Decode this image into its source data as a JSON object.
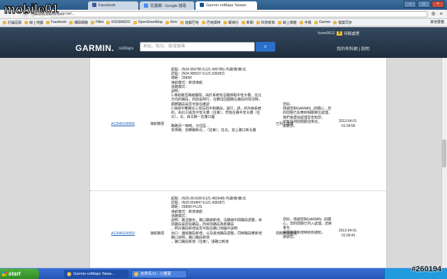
{
  "watermark": {
    "logo": "mobile01",
    "sub": "www.mobile01.com",
    "post_id": "#260194"
  },
  "browser": {
    "tabs": [
      {
        "label": "Facebook",
        "active": false
      },
      {
        "label": "花蓮網 - Google 搜尋",
        "active": false
      },
      {
        "label": "Garmin nüMaps Taiwan",
        "active": true
      }
    ],
    "url": "garmin.tw/...",
    "bookmarks": [
      "討論區版",
      "線上地圖",
      "Facebook",
      "博碩網路",
      "Hifiet",
      "KISSRADIO",
      "OpenStreetMap",
      "Kimi",
      "遊戲巴哈",
      "巴哈姆特",
      "報導社",
      "新聞",
      "科技新知",
      "線上媒體",
      "手機",
      "Garmin",
      "檔案同步"
    ],
    "other_bookmarks": "其他書籤"
  },
  "garmin": {
    "logo": "GARMIN.",
    "sub": "nüMaps",
    "search_placeholder": "地址、點位、區域搜尋",
    "user": "fumo0612",
    "user_badge": "0",
    "user_link": "待解處理",
    "header_links": "我的有料網 | 說明"
  },
  "records": [
    {
      "id": "A12040100006",
      "type": "導航路徑",
      "detail": "起點：(N24.954785 E121.495785) 內湖/南/東/北\n訖點：(N24.985027 E121.536952)\n總距：2585R\n導航模式：新增導航\n道路模式：\n說明：\n1.導航路至路線醫院，由於系統有沿路節點中安大橋，往北方向的路段，而如是明行，在轉往回圈路左路段的情況時，\n順轉路段是否可能在確認\n2.我經中華路往三安區的中和路段，過行，請，的外線系統的，由北引過去中安大橋（往東），然後在路中安大橋（往北），北，由北聯一在路口圖\n\n路路另一條時，分往區...\n安排路：自轉路新北...（往東），往北，加上路口新北路",
      "status": "已列入處理",
      "reply": "您好，\n感謝您對GARMIN...的關心，您的問題已反應到相關單位處理，\n我們會盡快處理並告知您，\n如有任何問題歡迎來信，\n謝謝您。",
      "date": "2012-04-01",
      "time": "01:34:59"
    },
    {
      "id": "A12040100003",
      "type": "導航路徑",
      "detail": "起點：(N25.061528 E121.482648) 內湖/南/東/北\n訖點：(N25.050847 E121.438387)\n總距：2585R PLUS\n導航模式：新增導航\n道路模式：\n說明：路況變化，路口路線新增，沿路線中間路段調整，目前路段是原始路段，而目前路段為新路段\n，照片路段新增是否可能在路口地圖中說明\n出口：播放路段新增，以及其他路段調整，同時路段應新增路口說明，路口路段新增\n，路口路段新增（往東），請路口新增",
      "status": "問題無法處理",
      "reply": "您好，感謝您對GARMIN...的關心，您的問題已列入處理，您將會在\n相關路段新增時收到通知，\n謝謝您。",
      "date": "2012-04-01",
      "time": "01:09:43"
    }
  ],
  "taskbar": {
    "start": "start",
    "tasks": [
      {
        "label": "Garmin nüMaps Taiwa...",
        "active": true
      },
      {
        "label": "未命名13 - 小畫家",
        "active": false
      }
    ]
  }
}
